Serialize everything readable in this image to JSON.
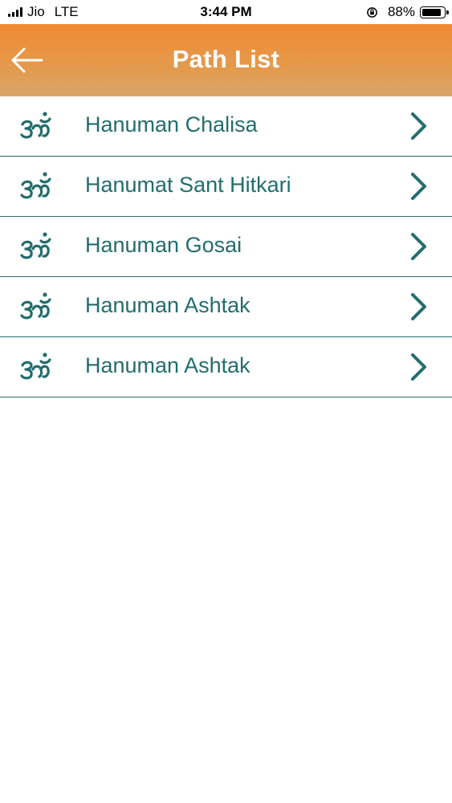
{
  "status_bar": {
    "carrier": "Jio",
    "network": "LTE",
    "time": "3:44 PM",
    "battery": "88%"
  },
  "header": {
    "title": "Path List",
    "back_icon": "back-arrow-icon"
  },
  "list": {
    "item_icon": "om-icon",
    "trailing_icon": "chevron-right-icon",
    "items": [
      {
        "label": "Hanuman Chalisa"
      },
      {
        "label": "Hanumat Sant Hitkari"
      },
      {
        "label": "Hanuman Gosai"
      },
      {
        "label": "Hanuman Ashtak"
      },
      {
        "label": "Hanuman Ashtak"
      }
    ]
  },
  "colors": {
    "header_top": "#f08a33",
    "header_bottom": "#d9a56a",
    "accent_teal": "#236d6d"
  }
}
